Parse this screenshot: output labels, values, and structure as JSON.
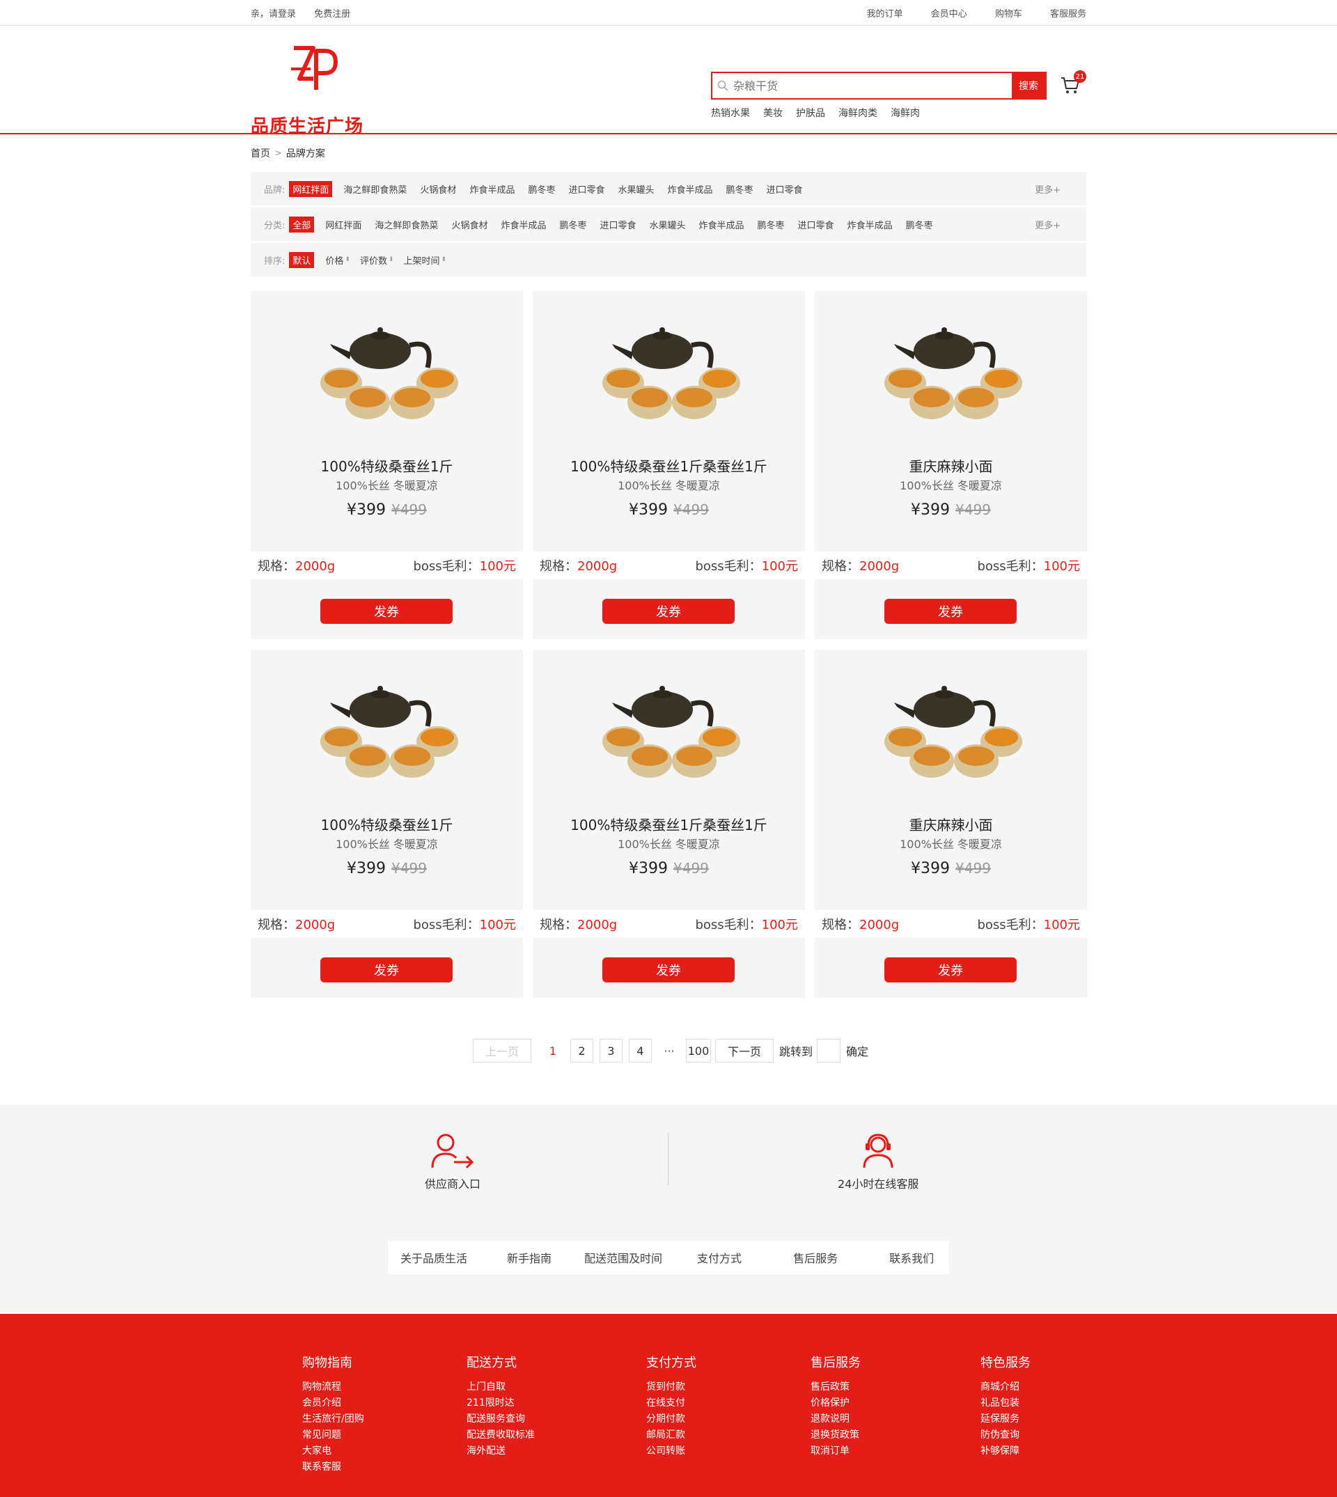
{
  "topbar": {
    "login": "亲，请登录",
    "register": "免费注册",
    "links": [
      "我的订单",
      "会员中心",
      "购物车",
      "客服服务"
    ]
  },
  "header": {
    "logo_text": "品质生活广场",
    "search_placeholder": "杂粮干货",
    "search_button": "搜索",
    "cart_count": "21",
    "hotwords": [
      "热销水果",
      "美妆",
      "护肤品",
      "海鲜肉类",
      "海鲜肉"
    ]
  },
  "breadcrumb": {
    "home": "首页",
    "sep": ">",
    "current": "品牌方案"
  },
  "filters": {
    "brand": {
      "label": "品牌:",
      "active": "网红拌面",
      "items": [
        "海之鲜即食熟菜",
        "火锅食材",
        "炸食半成品",
        "鹏冬枣",
        "进口零食",
        "水果罐头",
        "炸食半成品",
        "鹏冬枣",
        "进口零食"
      ],
      "more": "更多+"
    },
    "category": {
      "label": "分类:",
      "active": "全部",
      "items": [
        "网红拌面",
        "海之鲜即食熟菜",
        "火锅食材",
        "炸食半成品",
        "鹏冬枣",
        "进口零食",
        "水果罐头",
        "炸食半成品",
        "鹏冬枣",
        "进口零食",
        "炸食半成品",
        "鹏冬枣"
      ],
      "more": "更多+"
    },
    "sort": {
      "label": "排序:",
      "active": "默认",
      "items": [
        "价格",
        "评价数",
        "上架时间"
      ]
    }
  },
  "products": [
    {
      "name": "100%特级桑蚕丝1斤",
      "sub": "100%长丝 冬暖夏凉",
      "price": "¥399",
      "old_price": "¥499",
      "spec_label": "规格：",
      "spec": "2000g",
      "profit_label": "boss毛利：",
      "profit": "100元",
      "button": "发券"
    },
    {
      "name": "100%特级桑蚕丝1斤桑蚕丝1斤",
      "sub": "100%长丝 冬暖夏凉",
      "price": "¥399",
      "old_price": "¥499",
      "spec_label": "规格：",
      "spec": "2000g",
      "profit_label": "boss毛利：",
      "profit": "100元",
      "button": "发券"
    },
    {
      "name": "重庆麻辣小面",
      "sub": "100%长丝 冬暖夏凉",
      "price": "¥399",
      "old_price": "¥499",
      "spec_label": "规格：",
      "spec": "2000g",
      "profit_label": "boss毛利：",
      "profit": "100元",
      "button": "发券"
    },
    {
      "name": "100%特级桑蚕丝1斤",
      "sub": "100%长丝 冬暖夏凉",
      "price": "¥399",
      "old_price": "¥499",
      "spec_label": "规格：",
      "spec": "2000g",
      "profit_label": "boss毛利：",
      "profit": "100元",
      "button": "发券"
    },
    {
      "name": "100%特级桑蚕丝1斤桑蚕丝1斤",
      "sub": "100%长丝 冬暖夏凉",
      "price": "¥399",
      "old_price": "¥499",
      "spec_label": "规格：",
      "spec": "2000g",
      "profit_label": "boss毛利：",
      "profit": "100元",
      "button": "发券"
    },
    {
      "name": "重庆麻辣小面",
      "sub": "100%长丝 冬暖夏凉",
      "price": "¥399",
      "old_price": "¥499",
      "spec_label": "规格：",
      "spec": "2000g",
      "profit_label": "boss毛利：",
      "profit": "100元",
      "button": "发券"
    }
  ],
  "pagination": {
    "prev": "上一页",
    "current": "1",
    "pages": [
      "2",
      "3",
      "4"
    ],
    "dots": "···",
    "last": "100",
    "next": "下一页",
    "jump_label": "跳转到",
    "confirm": "确定"
  },
  "services": {
    "supplier": "供应商入口",
    "support": "24小时在线客服",
    "links": [
      "关于品质生活",
      "新手指南",
      "配送范围及时间",
      "支付方式",
      "售后服务",
      "联系我们"
    ]
  },
  "footer": {
    "columns": [
      {
        "title": "购物指南",
        "items": [
          "购物流程",
          "会员介绍",
          "生活旅行/团购",
          "常见问题",
          "大家电",
          "联系客服"
        ]
      },
      {
        "title": "配送方式",
        "items": [
          "上门自取",
          "211限时达",
          "配送服务查询",
          "配送费收取标准",
          "海外配送"
        ]
      },
      {
        "title": "支付方式",
        "items": [
          "货到付款",
          "在线支付",
          "分期付款",
          "邮局汇款",
          "公司转账"
        ]
      },
      {
        "title": "售后服务",
        "items": [
          "售后政策",
          "价格保护",
          "退款说明",
          "退换货政策",
          "取消订单"
        ]
      },
      {
        "title": "特色服务",
        "items": [
          "商城介绍",
          "礼品包装",
          "延保服务",
          "防伪查询",
          "补够保障"
        ]
      }
    ]
  },
  "colors": {
    "brand_red": "#e31e18",
    "panel_gray": "#f5f5f5"
  },
  "icons": [
    "search-icon",
    "cart-icon",
    "breadcrumb-chevron-icon",
    "sort-arrows-icon",
    "supplier-icon",
    "headset-icon"
  ]
}
